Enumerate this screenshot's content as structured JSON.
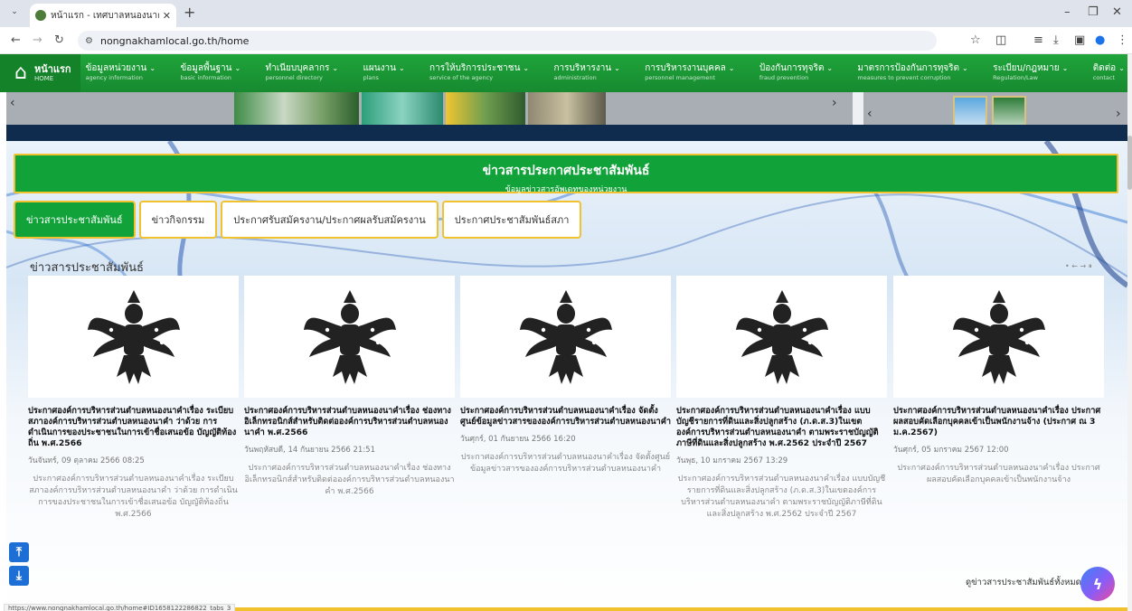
{
  "browser": {
    "tab_title": "หน้าแรก - เทศบาลหนองนาคำ อ.เมือง",
    "url_site_icon": "site-info-icon",
    "url": "nongnakhamlocal.go.th/home",
    "status_url": "https://www.nongnakhamlocal.go.th/home#ID1658122286822_tabs_3"
  },
  "nav": {
    "home_label": "หน้าแรก",
    "home_sub": "HOME",
    "items": [
      {
        "label": "ข้อมูลหน่วยงาน",
        "sub": "agency information"
      },
      {
        "label": "ข้อมูลพื้นฐาน",
        "sub": "basic information"
      },
      {
        "label": "ทำเนียบบุคลากร",
        "sub": "personnel directory"
      },
      {
        "label": "แผนงาน",
        "sub": "plans"
      },
      {
        "label": "การให้บริการประชาชน",
        "sub": "service of the agency"
      },
      {
        "label": "การบริหารงาน",
        "sub": "administration"
      },
      {
        "label": "การบริหารงานบุคคล",
        "sub": "personnel management"
      },
      {
        "label": "ป้องกันการทุจริต",
        "sub": "fraud prevention"
      },
      {
        "label": "มาตรการป้องกันการทุจริต",
        "sub": "measures to prevent corruption"
      },
      {
        "label": "ระเบียบ/กฎหมาย",
        "sub": "Regulation/Law"
      },
      {
        "label": "ติดต่อ",
        "sub": "contact"
      }
    ]
  },
  "news": {
    "heading": "ข่าวสารประกาศประชาสัมพันธ์",
    "subheading": "ข้อมูลข่าวสารอัพเดทของหน่วยงาน",
    "tabs": [
      "ข่าวสารประชาสัมพันธ์",
      "ข่าวกิจกรรม",
      "ประกาศรับสมัครงาน/ประกาศผลรับสมัครงาน",
      "ประกาศประชาสัมพันธ์สภา"
    ],
    "section_title": "ข่าวสารประชาสัมพันธ์",
    "carousel_controls": "• ← → ⏸",
    "view_all": "ดูข่าวสารประชาสัมพันธ์ทั้งหมด",
    "cards": [
      {
        "title": "ประกาศองค์การบริหารส่วนตำบลหนองนาคำเรื่อง ระเบียบสภาองค์การบริหารส่วนตำบลหนองนาคำ ว่าด้วย การดำเนินการของประชาชนในการเข้าชื่อเสนอข้อ บัญญัติท้องถิ่น พ.ศ.2566",
        "date": "วันจันทร์, 09 ตุลาคม 2566 08:25",
        "excerpt": "ประกาศองค์การบริหารส่วนตำบลหนองนาคำเรื่อง ระเบียบสภาองค์การบริหารส่วนตำบลหนองนาคำ ว่าด้วย การดำเนินการของประชาชนในการเข้าชื่อเสนอข้อ บัญญัติท้องถิ่น พ.ศ.2566"
      },
      {
        "title": "ประกาศองค์การบริหารส่วนตำบลหนองนาคำเรื่อง ช่องทางอิเล็กทรอนิกส์สำหรับติดต่อองค์การบริหารส่วนตำบลหนองนาคำ พ.ศ.2566",
        "date": "วันพฤหัสบดี, 14 กันยายน 2566 21:51",
        "excerpt": "ประกาศองค์การบริหารส่วนตำบลหนองนาคำเรื่อง ช่องทางอิเล็กทรอนิกส์สำหรับติดต่อองค์การบริหารส่วนตำบลหนองนาคำ พ.ศ.2566"
      },
      {
        "title": "ประกาศองค์การบริหารส่วนตำบลหนองนาคำเรื่อง จัดตั้งศูนย์ข้อมูลข่าวสารขององค์การบริหารส่วนตำบลหนองนาคำ",
        "date": "วันศุกร์, 01 กันยายน 2566 16:20",
        "excerpt": "ประกาศองค์การบริหารส่วนตำบลหนองนาคำเรื่อง จัดตั้งศูนย์ข้อมูลข่าวสารขององค์การบริหารส่วนตำบลหนองนาคำ"
      },
      {
        "title": "ประกาศองค์การบริหารส่วนตำบลหนองนาคำเรื่อง แบบบัญชีรายการที่ดินและสิ่งปลูกสร้าง (ภ.ด.ส.3)ในเขตองค์การบริหารส่วนตำบลหนองนาคำ ตามพระราชบัญญัติภาษีที่ดินและสิ่งปลูกสร้าง พ.ศ.2562 ประจำปี 2567",
        "date": "วันพุธ, 10 มกราคม 2567 13:29",
        "excerpt": "ประกาศองค์การบริหารส่วนตำบลหนองนาคำเรื่อง แบบบัญชีรายการที่ดินและสิ่งปลูกสร้าง (ภ.ด.ส.3)ในเขตองค์การบริหารส่วนตำบลหนองนาคำ ตามพระราชบัญญัติภาษีที่ดินและสิ่งปลูกสร้าง พ.ศ.2562 ประจำปี 2567"
      },
      {
        "title": "ประกาศองค์การบริหารส่วนตำบลหนองนาคำเรื่อง ประกาศผลสอบคัดเลือกบุคคลเข้าเป็นพนักงานจ้าง (ประกาศ ณ 3 ม.ค.2567)",
        "date": "วันศุกร์, 05 มกราคม 2567 12:00",
        "excerpt": "ประกาศองค์การบริหารส่วนตำบลหนองนาคำเรื่อง ประกาศผลสอบคัดเลือกบุคคลเข้าเป็นพนักงานจ้าง"
      }
    ]
  },
  "colors": {
    "accent_green": "#11a33a",
    "gold_border": "#f2c12e",
    "dark_band": "#0f2b4d"
  }
}
